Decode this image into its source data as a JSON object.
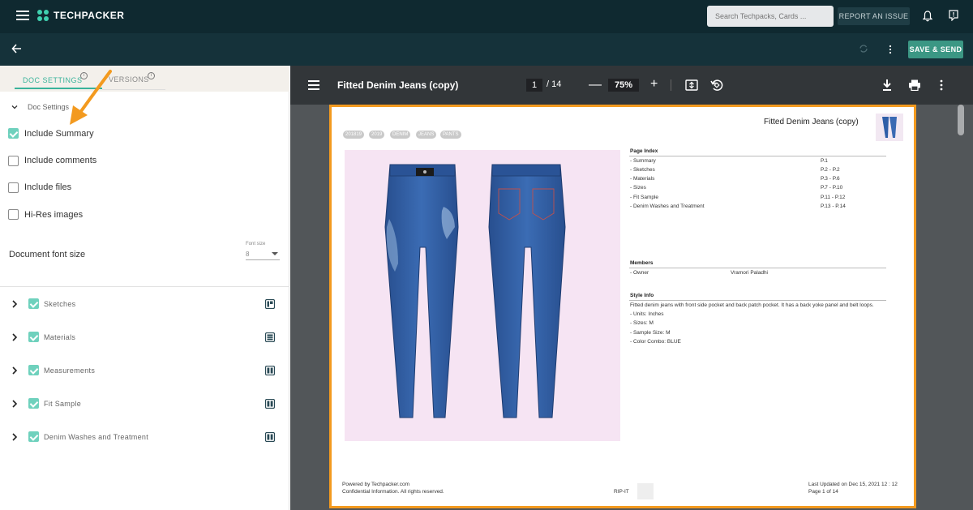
{
  "header": {
    "brand": "TECHPACKER",
    "search_placeholder": "Search Techpacks, Cards ...",
    "report_issue": "REPORT AN ISSUE"
  },
  "subbar": {
    "save_send": "SAVE & SEND"
  },
  "left_panel": {
    "tabs": [
      {
        "label": "DOC SETTINGS",
        "active": true
      },
      {
        "label": "VERSIONS",
        "active": false
      }
    ],
    "doc_settings_label": "Doc Settings",
    "options": [
      {
        "label": "Include Summary",
        "checked": true
      },
      {
        "label": "Include comments",
        "checked": false
      },
      {
        "label": "Include files",
        "checked": false
      },
      {
        "label": "Hi-Res images",
        "checked": false
      }
    ],
    "font_size": {
      "label": "Document font size",
      "mini_label": "Font size",
      "value": "8"
    },
    "sections": [
      {
        "label": "Sketches",
        "checked": true,
        "icon": "layout-3col-icon"
      },
      {
        "label": "Materials",
        "checked": true,
        "icon": "grid-icon"
      },
      {
        "label": "Measurements",
        "checked": true,
        "icon": "layout-2col-icon"
      },
      {
        "label": "Fit Sample",
        "checked": true,
        "icon": "layout-2col-icon"
      },
      {
        "label": "Denim Washes and Treatment",
        "checked": true,
        "icon": "layout-2col-icon"
      }
    ]
  },
  "viewer": {
    "title": "Fitted Denim Jeans (copy)",
    "page_current": "1",
    "page_total": "/ 14",
    "zoom": "75%",
    "minus": "—",
    "plus": "+"
  },
  "document": {
    "title": "Fitted Denim Jeans (copy)",
    "tags": [
      "201819",
      "2019",
      "DENIM",
      "JEANS",
      "PANTS"
    ],
    "page_index_title": "Page Index",
    "page_index": [
      {
        "name": "- Summary",
        "pages": "P.1"
      },
      {
        "name": "- Sketches",
        "pages": "P.2 - P.2"
      },
      {
        "name": "- Materials",
        "pages": "P.3 - P.6"
      },
      {
        "name": "- Sizes",
        "pages": "P.7 - P.10"
      },
      {
        "name": "- Fit Sample",
        "pages": "P.11 - P.12"
      },
      {
        "name": "- Denim Washes and Treatment",
        "pages": "P.13 - P.14"
      }
    ],
    "members_title": "Members",
    "member_role": "- Owner",
    "member_name": "Vramori Paladhi",
    "style_info_title": "Style Info",
    "style_info": [
      "Fitted denim jeans with front side pocket and back patch pocket. It has a back yoke panel and belt loops.",
      "- Units: Inches",
      "- Sizes: M",
      "- Sample Size: M",
      "- Color Combo: BLUE"
    ],
    "footer": {
      "powered": "Powered by Techpacker.com",
      "confidential": "Confidential Information. All rights reserved.",
      "code": "RIP-IT",
      "updated": "Last Updated on Dec 15, 2021 12 : 12",
      "page": "Page 1 of 14"
    }
  },
  "colors": {
    "accent": "#3ab39b",
    "checkbox": "#6fd1bd",
    "page_border": "#f39a1f",
    "header_bg": "#0f2930",
    "denim": "#2f5fa8"
  }
}
